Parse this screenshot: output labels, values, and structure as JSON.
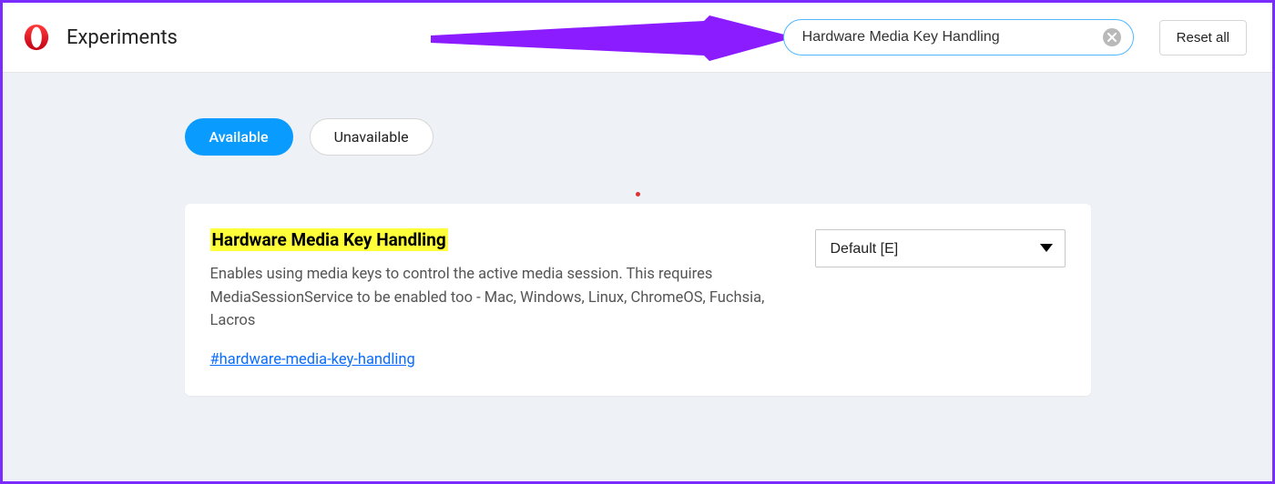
{
  "header": {
    "title": "Experiments",
    "search_value": "Hardware Media Key Handling",
    "reset_label": "Reset all"
  },
  "tabs": {
    "available": "Available",
    "unavailable": "Unavailable"
  },
  "flag": {
    "title": "Hardware Media Key Handling",
    "description": "Enables using media keys to control the active media session. This requires MediaSessionService to be enabled too - Mac, Windows, Linux, ChromeOS, Fuchsia, Lacros",
    "link": "#hardware-media-key-handling",
    "select_value": "Default [E]"
  }
}
